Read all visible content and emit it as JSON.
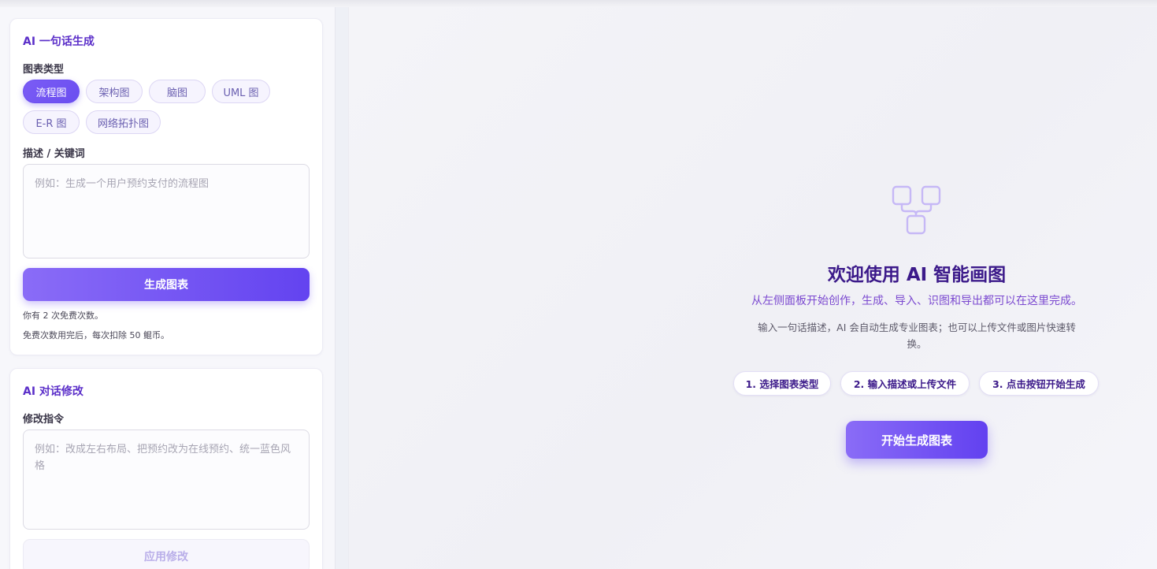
{
  "sidebar": {
    "ai_generate": {
      "title": "AI 一句话生成",
      "type_label": "图表类型",
      "chart_types": [
        "流程图",
        "架构图",
        "脑图",
        "UML 图",
        "E-R 图",
        "网络拓扑图"
      ],
      "selected_type": "流程图",
      "desc_label": "描述 / 关键词",
      "desc_placeholder": "例如：生成一个用户预约支付的流程图",
      "generate_button": "生成图表",
      "free_count_note": "你有 2 次免费次数。",
      "cost_note": "免费次数用完后，每次扣除 50 鲲币。"
    },
    "ai_edit": {
      "title": "AI 对话修改",
      "instruction_label": "修改指令",
      "instruction_placeholder": "例如：改成左右布局、把预约改为在线预约、统一蓝色风格",
      "apply_button": "应用修改"
    }
  },
  "main": {
    "icon": "diagram-nodes-icon",
    "title": "欢迎使用 AI 智能画图",
    "subtitle": "从左侧面板开始创作，生成、导入、识图和导出都可以在这里完成。",
    "description": "输入一句话描述，AI 会自动生成专业图表；也可以上传文件或图片快速转换。",
    "steps": [
      "1. 选择图表类型",
      "2. 输入描述或上传文件",
      "3. 点击按钮开始生成"
    ],
    "start_button": "开始生成图表"
  },
  "colors": {
    "accent": "#6a4ef0",
    "title_purple": "#5b2fc9",
    "dark_purple": "#3c1a8a"
  }
}
